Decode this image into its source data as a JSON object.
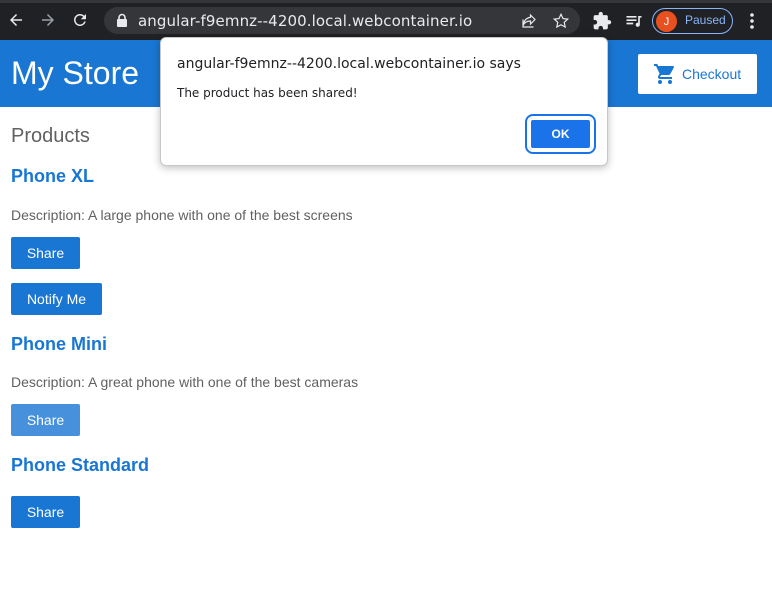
{
  "browser": {
    "url": "angular-f9emnz--4200.local.webcontainer.io",
    "profile_initial": "J",
    "profile_status": "Paused"
  },
  "app": {
    "title": "My Store",
    "checkout_label": "Checkout"
  },
  "products": {
    "heading": "Products",
    "items": [
      {
        "name": "Phone XL",
        "description": "Description: A large phone with one of the best screens",
        "share_label": "Share",
        "notify_label": "Notify Me"
      },
      {
        "name": "Phone Mini",
        "description": "Description: A great phone with one of the best cameras",
        "share_label": "Share"
      },
      {
        "name": "Phone Standard",
        "share_label": "Share"
      }
    ]
  },
  "dialog": {
    "title": "angular-f9emnz--4200.local.webcontainer.io says",
    "message": "The product has been shared!",
    "ok_label": "OK"
  },
  "colors": {
    "brand": "#1976d2",
    "chrome": "#202124",
    "dialog_button": "#1a73e8"
  }
}
